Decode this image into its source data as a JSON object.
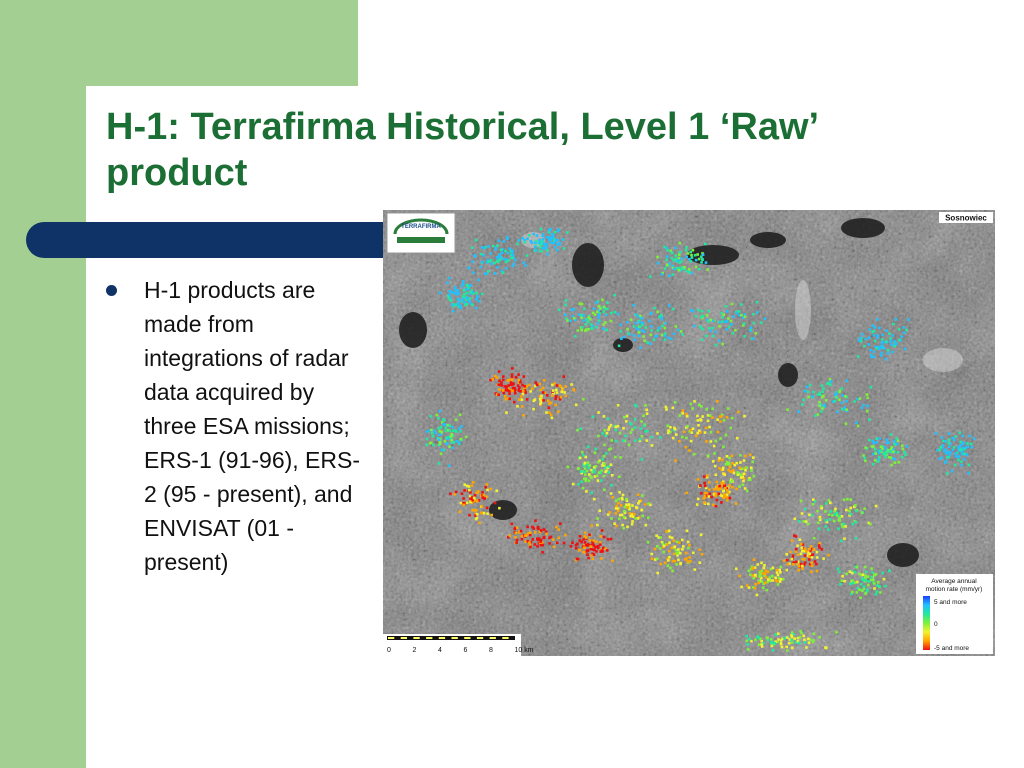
{
  "slide": {
    "title_line1": "H-1: Terrafirma Historical, Level 1 ‘Raw’",
    "title_line2": "product",
    "bullet_text": "H-1 products are made from integrations of radar data acquired by three ESA missions; ERS-1 (91-96), ERS-2 (95 - present), and ENVISAT (01 - present)"
  },
  "map": {
    "place_label": "Sosnowiec",
    "logo_text": "TERRAFIRMA",
    "legend": {
      "title_line1": "Average annual",
      "title_line2": "motion rate (mm/yr)",
      "label_top": "5 and more",
      "label_mid": "0",
      "label_bottom": "-5 and more",
      "colors": [
        "#1a3cff",
        "#22c0ff",
        "#22e8a0",
        "#7ef03a",
        "#f2f230",
        "#ffa500",
        "#f01010"
      ]
    },
    "scale": {
      "ticks": [
        "0",
        "2",
        "4",
        "6",
        "8",
        "10 km"
      ]
    }
  }
}
